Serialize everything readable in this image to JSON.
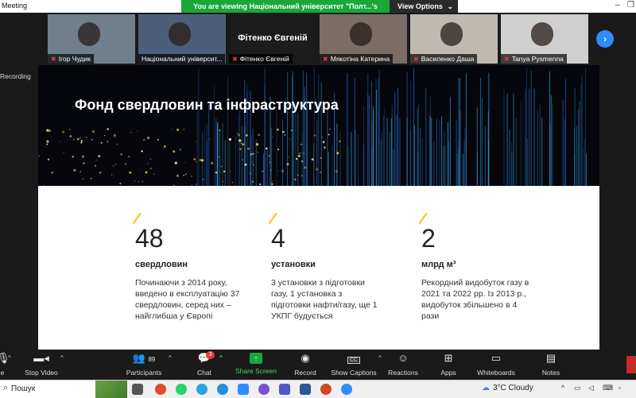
{
  "window": {
    "title": "Meeting"
  },
  "share_banner": {
    "text": "You are viewing Національний університет \"Полт...'s screen"
  },
  "view_options": {
    "label": "View Options",
    "icon": "chevron-down-icon"
  },
  "participants": [
    {
      "name": "Ігор Чудик",
      "muted": true,
      "display": "video",
      "bg": "#6f7f8c"
    },
    {
      "name": "Національний університ...",
      "muted": false,
      "display": "video",
      "bg": "#4d5e78"
    },
    {
      "name": "Фітенко Євгеній",
      "muted": true,
      "display": "name",
      "big_label": "Фітенко Євгеній",
      "bg": "#1c1c1c"
    },
    {
      "name": "Мякотіна Катерина",
      "muted": true,
      "display": "video",
      "bg": "#7a6e66"
    },
    {
      "name": "Василенко Даша",
      "muted": true,
      "display": "video",
      "bg": "#bfb9b2"
    },
    {
      "name": "Tanya Pysmenna",
      "muted": true,
      "display": "video",
      "bg": "#cfcfcf"
    }
  ],
  "recording_label": "Recording",
  "slide": {
    "title": "Фонд свердловин та інфраструктура",
    "stats": [
      {
        "number": "48",
        "label": "свердловин",
        "description": "Починаючи з 2014 року, введено в експлуатацію 37 свердловин, серед них – найглибша у Європі"
      },
      {
        "number": "4",
        "label": "установки",
        "description": "3 установки з підготовки газу, 1 установка з підготовки нафти/газу, ще 1 УКПГ будується"
      },
      {
        "number": "2",
        "label": "млрд м³",
        "description": "Рекордний видобуток газу в 2021 та 2022 рр. Із 2013 р., видобуток збільшено в 4 рази"
      }
    ],
    "accent_color": "#f4c300"
  },
  "toolbar": {
    "items": [
      {
        "label": "e",
        "icon": "mic-icon"
      },
      {
        "label": "Stop Video",
        "icon": "video-camera-icon"
      },
      {
        "label": "Participants",
        "icon": "participants-icon",
        "count": "89"
      },
      {
        "label": "Chat",
        "icon": "chat-icon",
        "badge": "3"
      },
      {
        "label": "Share Screen",
        "icon": "share-screen-icon"
      },
      {
        "label": "Record",
        "icon": "record-icon"
      },
      {
        "label": "Show Captions",
        "icon": "captions-icon"
      },
      {
        "label": "Reactions",
        "icon": "reactions-icon"
      },
      {
        "label": "Apps",
        "icon": "apps-icon"
      },
      {
        "label": "Whiteboards",
        "icon": "whiteboard-icon"
      },
      {
        "label": "Notes",
        "icon": "notes-icon"
      }
    ]
  },
  "taskbar": {
    "search_text": "Пошук",
    "weather": "3°C  Cloudy"
  }
}
